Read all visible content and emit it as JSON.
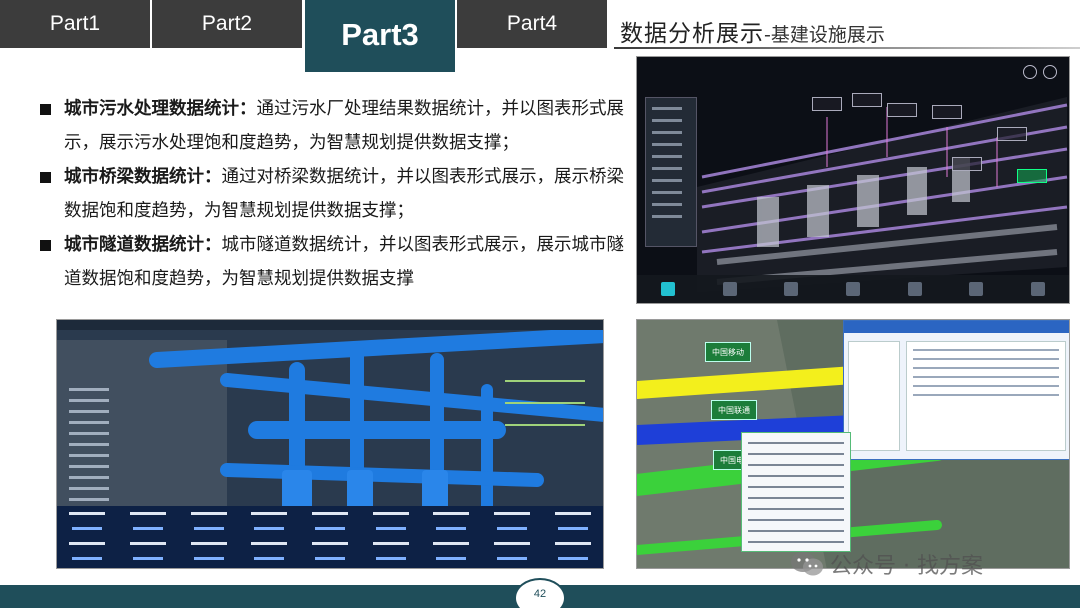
{
  "tabs": [
    {
      "label": "Part1",
      "active": false
    },
    {
      "label": "Part2",
      "active": false
    },
    {
      "label": "Part3",
      "active": true
    },
    {
      "label": "Part4",
      "active": false
    }
  ],
  "header": {
    "title": "数据分析展示",
    "subtitle": "-基建设施展示"
  },
  "bullets": [
    {
      "heading": "城市污水处理数据统计：",
      "text": "通过污水厂处理结果数据统计，并以图表形式展示，展示污水处理饱和度趋势，为智慧规划提供数据支撑；"
    },
    {
      "heading": "城市桥梁数据统计：",
      "text": "通过对桥梁数据统计，并以图表形式展示，展示桥梁数据饱和度趋势，为智慧规划提供数据支撑；"
    },
    {
      "heading": "城市隧道数据统计：",
      "text": "城市隧道数据统计，并以图表形式展示，展示城市隧道数据饱和度趋势，为智慧规划提供数据支撑"
    }
  ],
  "images": {
    "top_right": "bim-utility-tunnel-monitor",
    "bottom_left": "blue-pipeline-pump-room",
    "bottom_right": "tunnel-cable-management-system"
  },
  "tunnel_signs": [
    "中国移动",
    "中国联通",
    "中国电信"
  ],
  "watermark": "公众号 · 找方案",
  "page_number": "42",
  "colors": {
    "accent": "#1f4e5a",
    "tab_inactive": "#3c3c3c"
  }
}
